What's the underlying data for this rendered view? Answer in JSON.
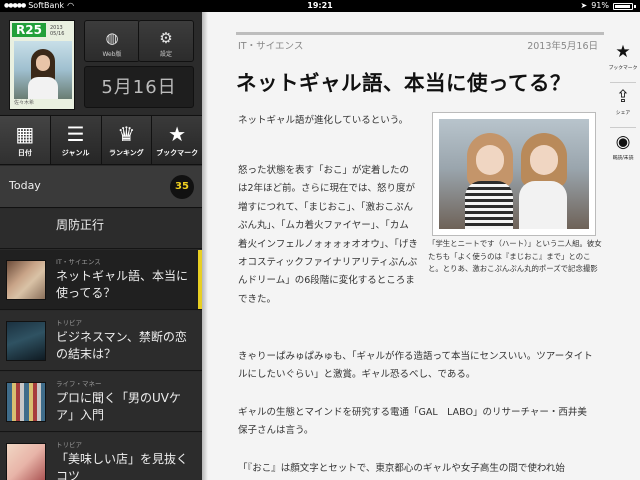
{
  "status_bar": {
    "carrier": "SoftBank",
    "time": "19:21",
    "battery": "91%"
  },
  "sidebar": {
    "magazine": {
      "logo": "R25",
      "issue": "2013 05/16",
      "caption": "佐々木希"
    },
    "top_buttons": [
      {
        "label": "Web版",
        "icon": "globe-icon"
      },
      {
        "label": "設定",
        "icon": "gear-icon"
      }
    ],
    "date": "5月16日",
    "nav": [
      {
        "label": "日付",
        "icon": "calendar-icon"
      },
      {
        "label": "ジャンル",
        "icon": "list-icon"
      },
      {
        "label": "ランキング",
        "icon": "crown-icon"
      },
      {
        "label": "ブックマーク",
        "icon": "star-icon"
      }
    ],
    "today": {
      "label": "Today",
      "count": "35"
    },
    "list": [
      {
        "category": "",
        "title": "周防正行"
      },
      {
        "category": "IT・サイエンス",
        "title": "ネットギャル語、本当に使ってる？"
      },
      {
        "category": "トリビア",
        "title": "ビジネスマン、禁断の恋の結末は？"
      },
      {
        "category": "ライフ・マネー",
        "title": "プロに聞く「男のUVケア」入門"
      },
      {
        "category": "トリビア",
        "title": "「美味しい店」を見抜くコツ"
      }
    ]
  },
  "article": {
    "category": "IT・サイエンス",
    "date": "2013年5月16日",
    "headline": "ネットギャル語、本当に使ってる？",
    "paragraphs": [
      "ネットギャル語が進化しているという。",
      "怒った状態を表す「おこ」が定着したのは2年ほど前。さらに現在では、怒り度が増すにつれて、「まじおこ」、「激おこぷんぷん丸」、「ムカ着火ファイヤー」、「カム着火インフェルノォォォォオオウ」、「げきオコスティックファイナリアリティぷんぷんドリーム」の6段階に変化するところまできた。",
      "きゃりーぱみゅぱみゅも、「ギャルが作る造語って本当にセンスいい。ツアータイトルにしたいぐらい」と激賞。ギャル恐るべし、である。",
      "ギャルの生態とマインドを研究する電通「GAL　LABO」のリサーチャー・西井美保子さんは言う。",
      "「『おこ』は顔文字とセットで、東京都心のギャルや女子高生の間で使われ始"
    ],
    "figure_caption": "「学生とニートです（ハート）」という二人組。彼女たちも「よく使うのは『まじおこ』まで」とのこと。とりあ、激おこぷんぷん丸的ポーズで記念撮影"
  },
  "toolbar": [
    {
      "label": "ブックマーク",
      "icon": "star-icon"
    },
    {
      "label": "シェア",
      "icon": "share-icon"
    },
    {
      "label": "既読/未読",
      "icon": "eye-icon"
    }
  ]
}
